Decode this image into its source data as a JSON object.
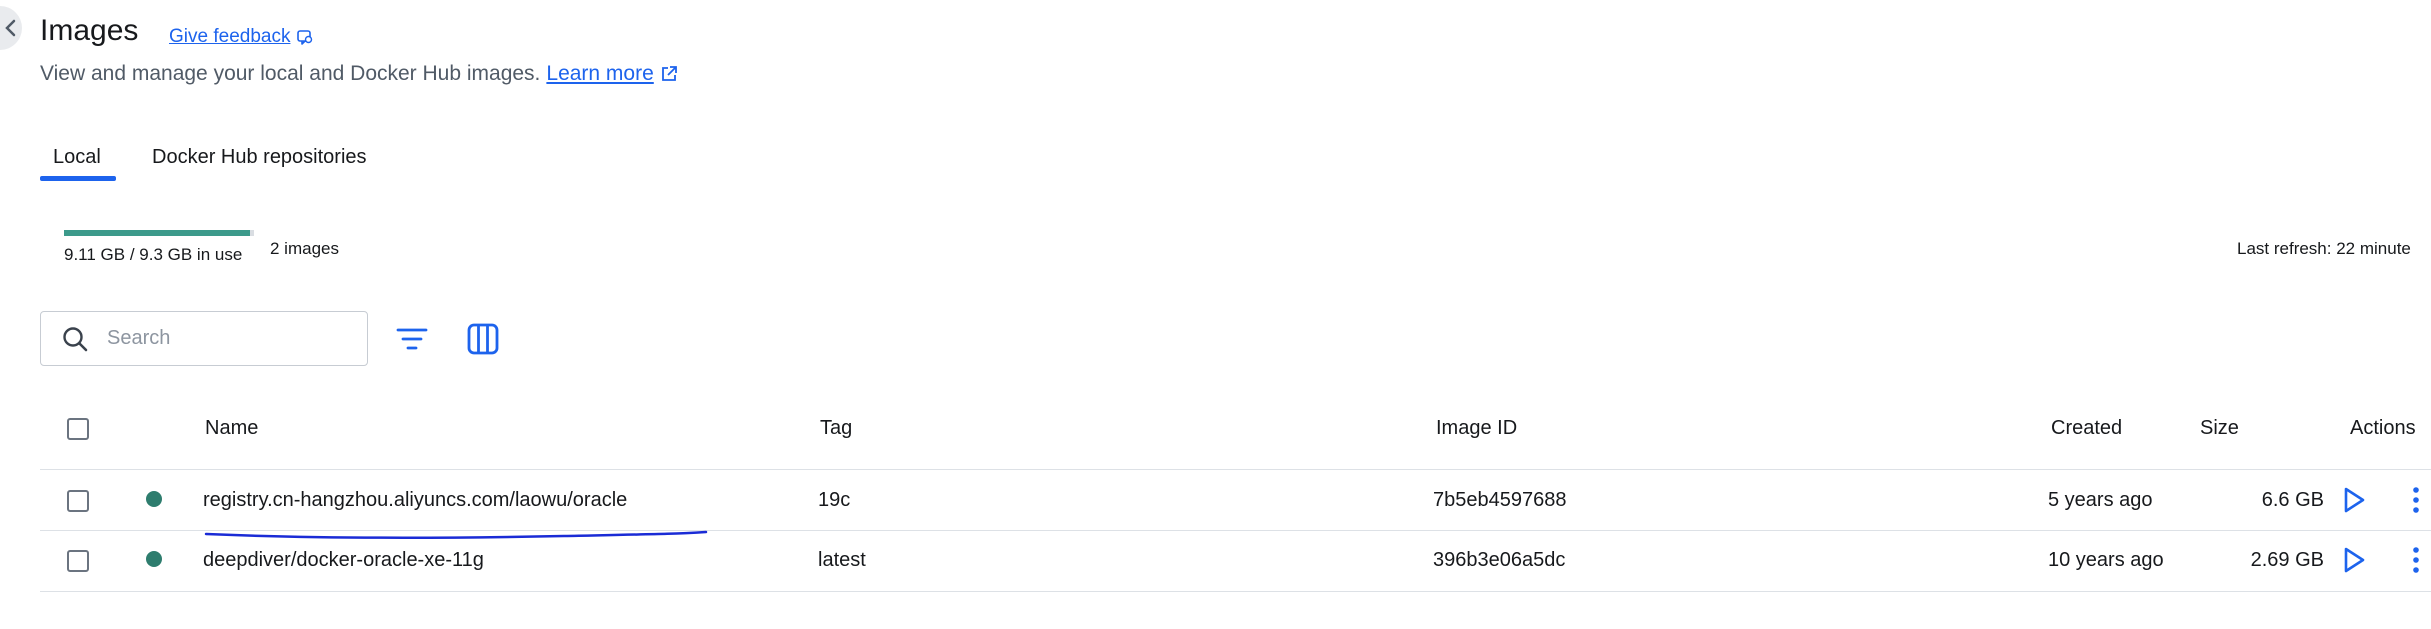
{
  "header": {
    "title": "Images",
    "feedback_label": "Give feedback",
    "subtitle": "View and manage your local and Docker Hub images.",
    "learn_more_label": "Learn more"
  },
  "tabs": [
    {
      "label": "Local",
      "active": true
    },
    {
      "label": "Docker Hub repositories",
      "active": false
    }
  ],
  "usage": {
    "text": "9.11 GB / 9.3 GB in use",
    "used_fraction": 0.98,
    "bar_color": "#3c9a8b",
    "image_count": "2 images",
    "last_refresh": "Last refresh: 22 minute"
  },
  "search": {
    "placeholder": "Search",
    "value": ""
  },
  "table": {
    "columns": {
      "name": "Name",
      "tag": "Tag",
      "image_id": "Image ID",
      "created": "Created",
      "size": "Size",
      "actions": "Actions"
    },
    "rows": [
      {
        "name": "registry.cn-hangzhou.aliyuncs.com/laowu/oracle",
        "tag": "19c",
        "image_id": "7b5eb4597688",
        "created": "5 years ago",
        "size": "6.6 GB",
        "status": "in-use"
      },
      {
        "name": "deepdiver/docker-oracle-xe-11g",
        "tag": "latest",
        "image_id": "396b3e06a5dc",
        "created": "10 years ago",
        "size": "2.69 GB",
        "status": "in-use"
      }
    ]
  },
  "colors": {
    "accent": "#1d63ed",
    "status_in_use": "#2e7d6e",
    "annotation_ink": "#1a2bd6"
  },
  "icons": {
    "back": "chevron-left-icon",
    "feedback": "feedback-icon",
    "external": "external-link-icon",
    "search": "search-icon",
    "filter": "filter-icon",
    "columns": "columns-icon",
    "run": "play-icon",
    "more": "more-vertical-icon"
  }
}
